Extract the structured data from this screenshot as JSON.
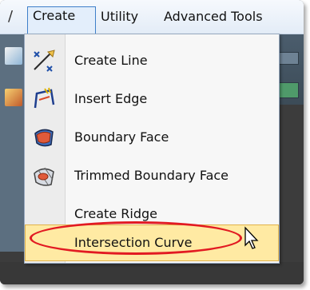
{
  "menubar": {
    "partial_left": "/",
    "items": [
      {
        "label": "Create",
        "active": true
      },
      {
        "label": "Utility",
        "active": false
      },
      {
        "label": "Advanced Tools",
        "active": false
      }
    ]
  },
  "dropdown": {
    "items": [
      {
        "label": "Create Line",
        "icon": "create-line-icon"
      },
      {
        "label": "Insert Edge",
        "icon": "insert-edge-icon"
      },
      {
        "label": "Boundary Face",
        "icon": "boundary-face-icon"
      },
      {
        "label": "Trimmed Boundary Face",
        "icon": "trimmed-boundary-face-icon"
      },
      {
        "label": "Create Ridge",
        "icon": null
      },
      {
        "label": "Intersection Curve",
        "icon": null,
        "highlighted": true
      }
    ]
  },
  "colors": {
    "highlight_fill": "#ffeaa3",
    "annotation_ring": "#e21a22",
    "active_menu_border": "#3e7fc9"
  }
}
